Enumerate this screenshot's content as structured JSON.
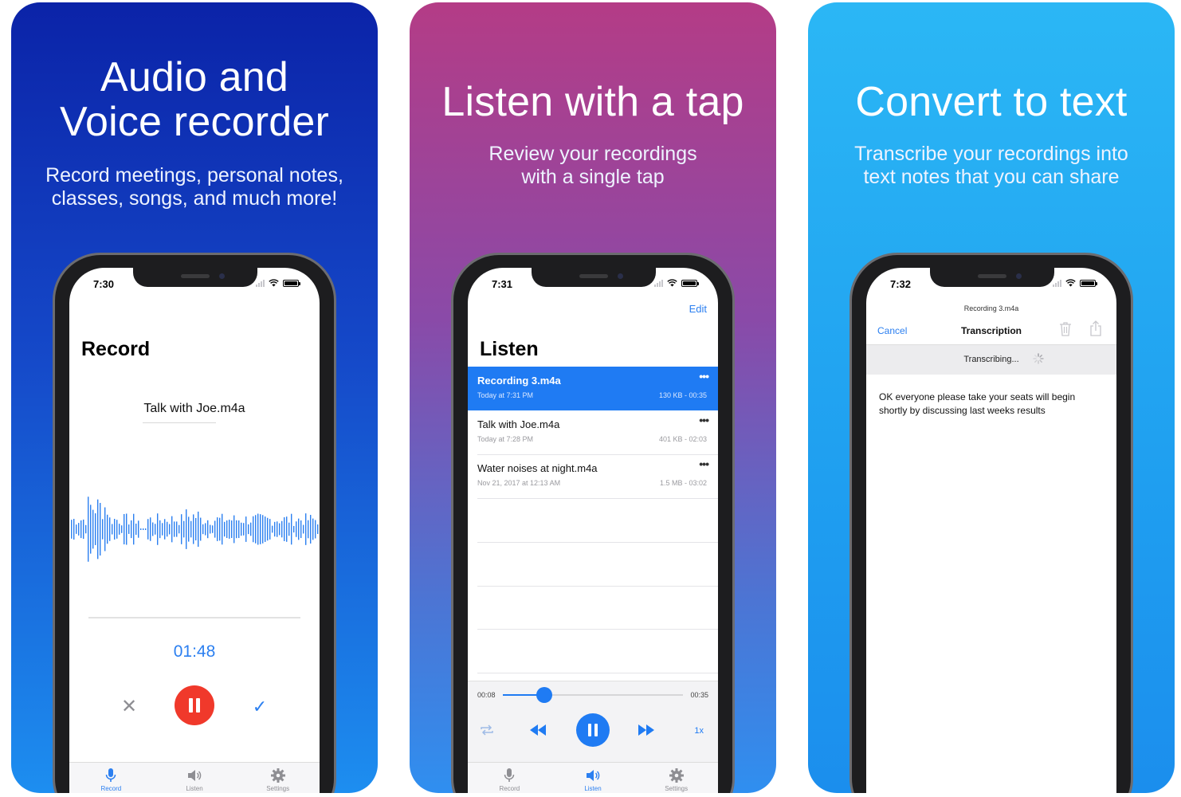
{
  "panels": [
    {
      "headline": [
        "Audio and",
        "Voice recorder"
      ],
      "subtitle": [
        "Record meetings, personal notes,",
        "classes, songs, and much more!"
      ],
      "phone": {
        "time": "7:30",
        "screen_title": "Record",
        "file_name": "Talk with Joe.m4a",
        "timer": "01:48"
      }
    },
    {
      "headline": [
        "Listen with a tap"
      ],
      "subtitle": [
        "Review your recordings",
        "with a single tap"
      ],
      "phone": {
        "time": "7:31",
        "edit_label": "Edit",
        "screen_title": "Listen",
        "recordings": [
          {
            "name": "Recording 3.m4a",
            "date": "Today at 7:31 PM",
            "size": "130 KB - 00:35",
            "more": "•••"
          },
          {
            "name": "Talk with Joe.m4a",
            "date": "Today at 7:28 PM",
            "size": "401 KB - 02:03",
            "more": "•••"
          },
          {
            "name": "Water noises at night.m4a",
            "date": "Nov 21, 2017 at 12:13 AM",
            "size": "1.5 MB - 03:02",
            "more": "•••"
          }
        ],
        "player": {
          "elapsed": "00:08",
          "duration": "00:35",
          "progress": 0.23,
          "speed": "1x"
        }
      }
    },
    {
      "headline": [
        "Convert to text"
      ],
      "subtitle": [
        "Transcribe your recordings into",
        "text notes that you can share"
      ],
      "phone": {
        "time": "7:32",
        "nav_subtitle": "Recording 3.m4a",
        "cancel_label": "Cancel",
        "nav_title": "Transcription",
        "status": "Transcribing...",
        "transcript": "OK everyone please take your seats will begin shortly by discussing last weeks results"
      }
    }
  ],
  "tabbar": {
    "record": "Record",
    "listen": "Listen",
    "settings": "Settings"
  },
  "colors": {
    "accent": "#1f7bf3",
    "record_red": "#f0392b"
  },
  "icons": [
    "mic-icon",
    "speaker-icon",
    "gear-icon",
    "trash-icon",
    "share-icon",
    "repeat-icon",
    "rewind-icon",
    "fast-forward-icon",
    "wifi-icon",
    "battery-icon"
  ]
}
